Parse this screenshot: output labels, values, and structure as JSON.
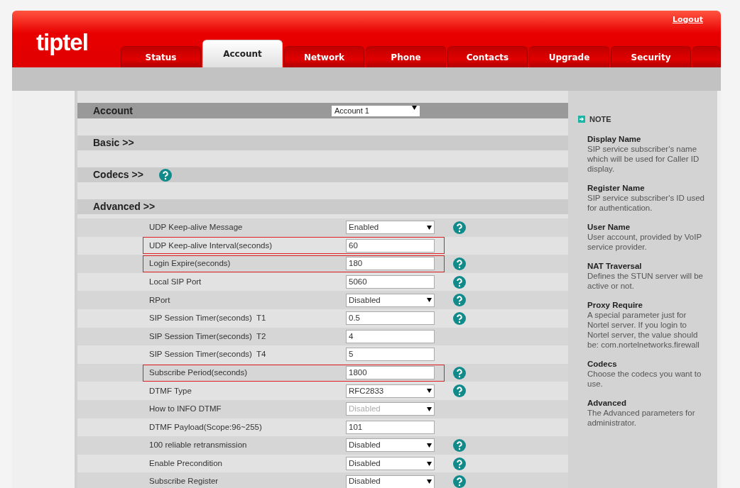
{
  "header": {
    "logo": "tiptel",
    "logout": "Logout"
  },
  "tabs": [
    {
      "label": "Status",
      "selected": false
    },
    {
      "label": "Account",
      "selected": true
    },
    {
      "label": "Network",
      "selected": false
    },
    {
      "label": "Phone",
      "selected": false
    },
    {
      "label": "Contacts",
      "selected": false
    },
    {
      "label": "Upgrade",
      "selected": false
    },
    {
      "label": "Security",
      "selected": false
    },
    {
      "selected": false
    }
  ],
  "account": {
    "label": "Account",
    "value": "Account 1"
  },
  "sections": [
    {
      "label": "Basic >>",
      "help": false
    },
    {
      "label": "Codecs >>",
      "help": true
    },
    {
      "label": "Advanced >>",
      "help": false
    }
  ],
  "settings": [
    {
      "label": "UDP Keep-alive Message",
      "kind": "select",
      "value": "Enabled",
      "help": true,
      "highlighted": false,
      "disabled": false
    },
    {
      "label": "UDP Keep-alive Interval(seconds)",
      "kind": "text",
      "value": "60",
      "help": false,
      "highlighted": true,
      "disabled": false
    },
    {
      "label": "Login Expire(seconds)",
      "kind": "text",
      "value": "180",
      "help": true,
      "highlighted": true,
      "disabled": false
    },
    {
      "label": "Local SIP Port",
      "kind": "text",
      "value": "5060",
      "help": true,
      "highlighted": false,
      "disabled": false
    },
    {
      "label": "RPort",
      "kind": "select",
      "value": "Disabled",
      "help": true,
      "highlighted": false,
      "disabled": false
    },
    {
      "label": "SIP Session Timer(seconds)  T1",
      "kind": "text",
      "value": "0.5",
      "help": true,
      "highlighted": false,
      "disabled": false
    },
    {
      "label": "SIP Session Timer(seconds)  T2",
      "kind": "text",
      "value": "4",
      "help": false,
      "highlighted": false,
      "disabled": false
    },
    {
      "label": "SIP Session Timer(seconds)  T4",
      "kind": "text",
      "value": "5",
      "help": false,
      "highlighted": false,
      "disabled": false
    },
    {
      "label": "Subscribe Period(seconds)",
      "kind": "text",
      "value": "1800",
      "help": true,
      "highlighted": true,
      "disabled": false
    },
    {
      "label": "DTMF Type",
      "kind": "select",
      "value": "RFC2833",
      "help": true,
      "highlighted": false,
      "disabled": false
    },
    {
      "label": "How to INFO DTMF",
      "kind": "select",
      "value": "Disabled",
      "help": false,
      "highlighted": false,
      "disabled": true
    },
    {
      "label": "DTMF Payload(Scope:96~255)",
      "kind": "text",
      "value": "101",
      "help": false,
      "highlighted": false,
      "disabled": false
    },
    {
      "label": "100 reliable retransmission",
      "kind": "select",
      "value": "Disabled",
      "help": true,
      "highlighted": false,
      "disabled": false
    },
    {
      "label": "Enable Precondition",
      "kind": "select",
      "value": "Disabled",
      "help": true,
      "highlighted": false,
      "disabled": false
    },
    {
      "label": "Subscribe Register",
      "kind": "select",
      "value": "Disabled",
      "help": true,
      "highlighted": false,
      "disabled": false
    }
  ],
  "note": {
    "title": "NOTE",
    "items": [
      {
        "title": "Display Name",
        "text": "SIP service subscriber's name which will be used for Caller ID display."
      },
      {
        "title": "Register Name",
        "text": "SIP service subscriber's ID used for authentication."
      },
      {
        "title": "User Name",
        "text": "User account, provided by VoIP service provider."
      },
      {
        "title": "NAT Traversal",
        "text": "Defines the STUN server will be active or not."
      },
      {
        "title": "Proxy Require",
        "text": "A special parameter just for Nortel server. If you login to Nortel server, the value should be: com.nortelnetworks.firewall"
      },
      {
        "title": "Codecs",
        "text": "Choose the codecs you want to use."
      },
      {
        "title": "Advanced",
        "text": "The Advanced parameters for administrator."
      }
    ]
  }
}
